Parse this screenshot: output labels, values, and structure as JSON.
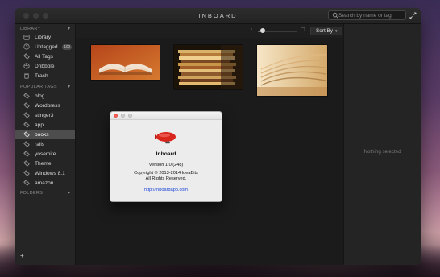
{
  "app": {
    "title": "INBOARD",
    "search_placeholder": "Search by name or tag"
  },
  "sidebar": {
    "library_section": "LIBRARY",
    "library_items": [
      {
        "label": "Library",
        "icon": "library-icon"
      },
      {
        "label": "Untagged",
        "icon": "question-icon",
        "badge": "100"
      },
      {
        "label": "All Tags",
        "icon": "tags-icon"
      },
      {
        "label": "Dribbble",
        "icon": "dribbble-icon"
      },
      {
        "label": "Trash",
        "icon": "trash-icon"
      }
    ],
    "popular_section": "POPULAR TAGS",
    "popular_tags": [
      {
        "label": "blog"
      },
      {
        "label": "Wordpress"
      },
      {
        "label": "stinger3"
      },
      {
        "label": "app"
      },
      {
        "label": "books",
        "selected": true
      },
      {
        "label": "rails"
      },
      {
        "label": "yosemite"
      },
      {
        "label": "Theme"
      },
      {
        "label": "Windows 8.1"
      },
      {
        "label": "amazon"
      }
    ],
    "folders_section": "FOLDERS",
    "add_label": "+"
  },
  "toolbar": {
    "sort_label": "Sort By",
    "zoom_level": 0.12
  },
  "right_panel": {
    "empty_text": "Nothing selected"
  },
  "about_dialog": {
    "app_name": "Inboard",
    "version": "Version 1.0 (248)",
    "copyright": "Copyright © 2013-2014 IdeaBits",
    "rights": "All Rights Reserved.",
    "link": "http://inboardapp.com"
  },
  "colors": {
    "selected_row": "#4d4d4d",
    "close_button": "#ff5e57",
    "link": "#1b45d8"
  }
}
